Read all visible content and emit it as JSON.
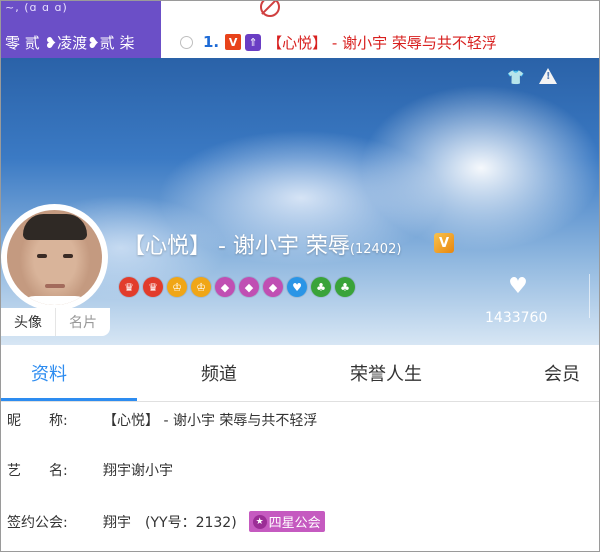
{
  "top": {
    "left_panel": {
      "status_text": "~, (ɑ ɑ ɑ)",
      "nickname": "零 贰 ❥凌渡❥贰 柒"
    },
    "list_item": {
      "index": "1.",
      "vip_badge": "V",
      "arrow_badge": "⇑",
      "name": "【心悦】 - 谢小宇 荣辱与共不轻浮"
    }
  },
  "profile": {
    "display_name": "【心悦】 - 谢小宇 荣辱",
    "uid": "(12402)",
    "v_badge": "V",
    "avatar_tabs": {
      "avatar": "头像",
      "card": "名片"
    },
    "likes": "1433760",
    "badge_colors": [
      "#e23c2b",
      "#e23c2b",
      "#f0a617",
      "#f0a617",
      "#c04fb3",
      "#c04fb3",
      "#c04fb3",
      "#2a95e6",
      "#3aa33a",
      "#3aa33a"
    ]
  },
  "tabs": [
    "资料",
    "频道",
    "荣誉人生",
    "会员"
  ],
  "info": {
    "nickname_label": "昵　　称:",
    "nickname_value": "【心悦】 - 谢小宇 荣辱与共不轻浮",
    "artist_label": "艺　　名:",
    "artist_value": "翔宇谢小宇",
    "guild_label": "签约公会:",
    "guild_value": "翔宇　(YY号：2132)",
    "guild_badge": "四星公会",
    "guild_badge_icon": "★"
  }
}
